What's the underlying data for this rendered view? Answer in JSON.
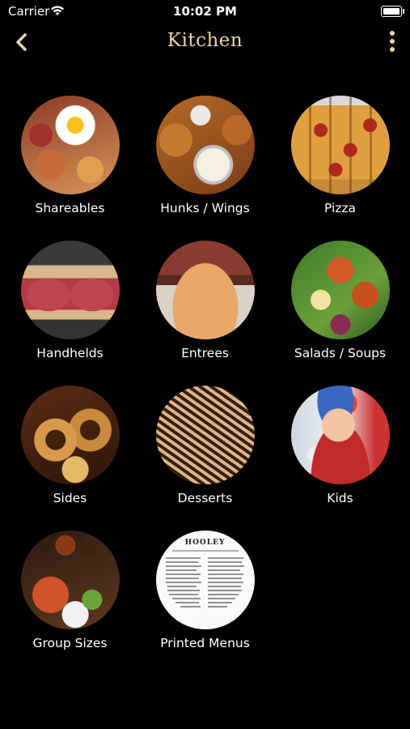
{
  "status_bar": {
    "carrier": "Carrier",
    "time": "10:02 PM",
    "icons": [
      "wifi-icon",
      "battery-icon"
    ]
  },
  "nav": {
    "title": "Kitchen",
    "back_icon": "chevron-left-icon",
    "more_icon": "more-vertical-icon",
    "accent_color": "#e8d6a8"
  },
  "categories": [
    {
      "label": "Shareables"
    },
    {
      "label": "Hunks / Wings"
    },
    {
      "label": "Pizza"
    },
    {
      "label": "Handhelds"
    },
    {
      "label": "Entrees"
    },
    {
      "label": "Salads / Soups"
    },
    {
      "label": "Sides"
    },
    {
      "label": "Desserts"
    },
    {
      "label": "Kids"
    },
    {
      "label": "Group Sizes"
    },
    {
      "label": "Printed Menus",
      "image_text": "HOOLEY"
    }
  ]
}
